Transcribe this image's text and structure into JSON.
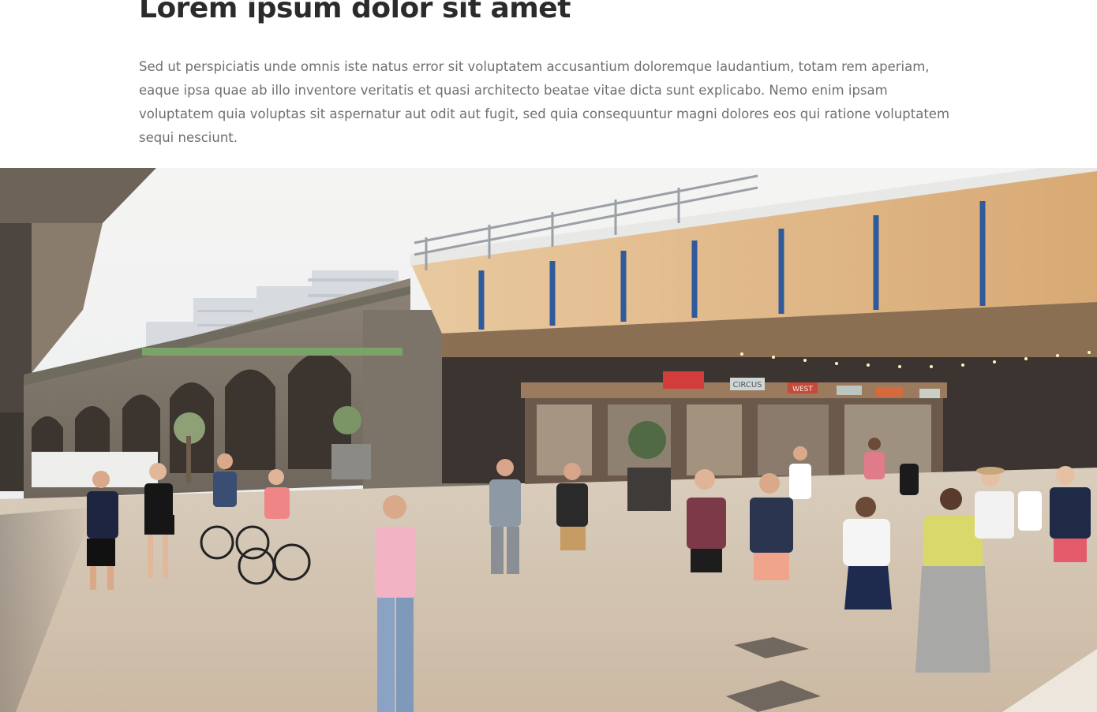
{
  "article": {
    "title": "Lorem ipsum dolor sit amet",
    "lede": "Sed ut perspiciatis unde omnis iste natus error sit voluptatem accusantium doloremque laudantium, totam rem aperiam, eaque ipsa quae ab illo inventore veritatis et quasi architecto beatae vitae dicta sunt explicabo. Nemo enim ipsam voluptatem quia voluptas sit aspernatur aut odit aut fugit, sed quia consequuntur magni dolores eos qui ratione voluptatem sequi nesciunt."
  },
  "hero_image": {
    "signs": [
      "CIRCUS",
      "WEST"
    ]
  }
}
